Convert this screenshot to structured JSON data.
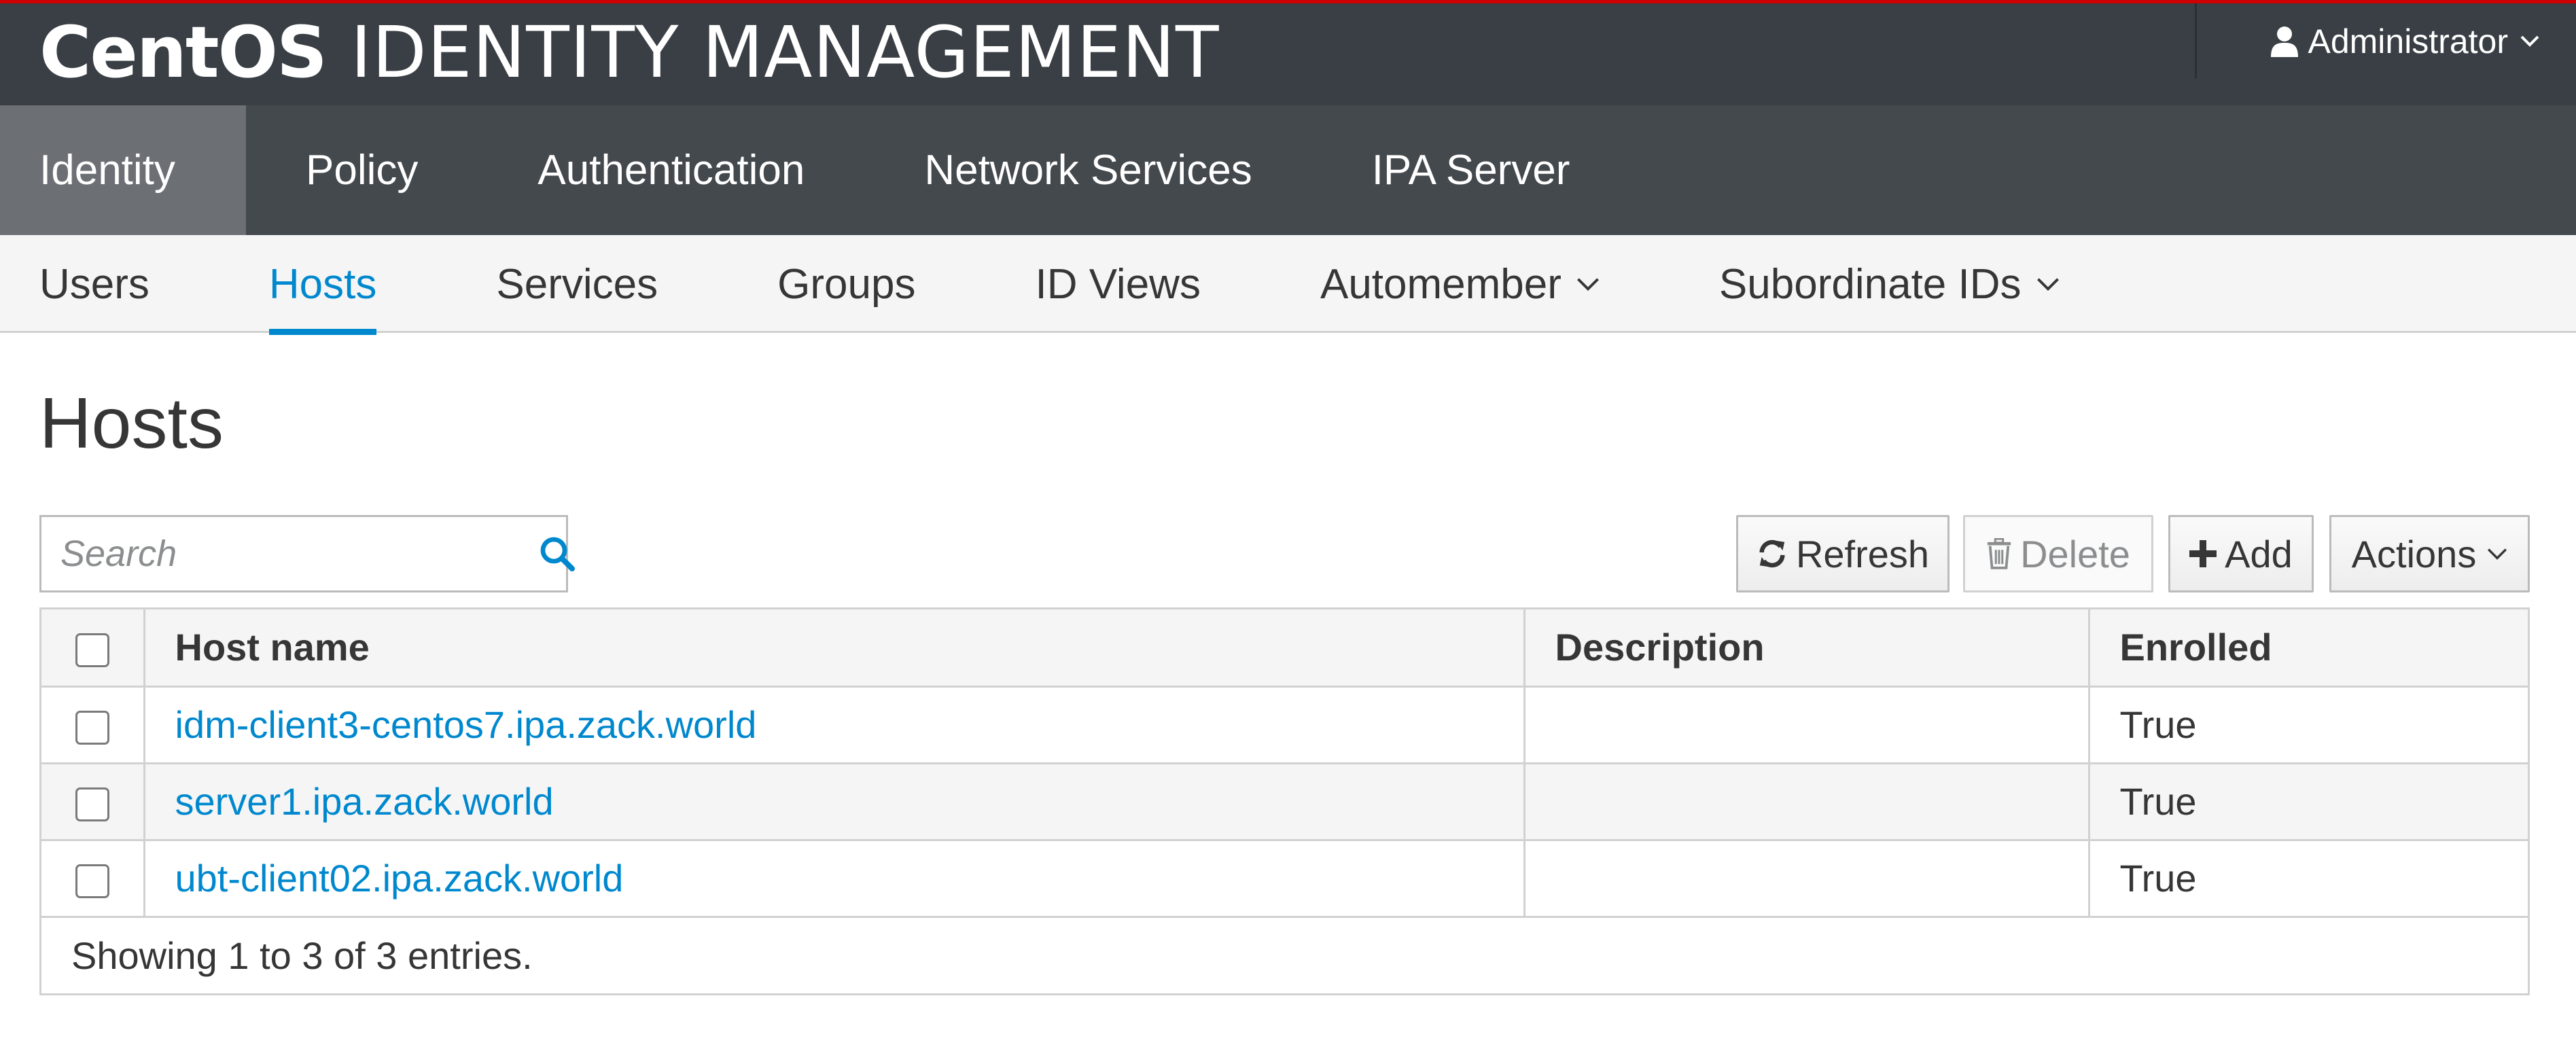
{
  "brand": {
    "bold": "CentOS",
    "light": "IDENTITY MANAGEMENT"
  },
  "user_menu": {
    "label": "Administrator",
    "icon": "user-icon"
  },
  "primary_nav": [
    {
      "label": "Identity",
      "active": true
    },
    {
      "label": "Policy",
      "active": false
    },
    {
      "label": "Authentication",
      "active": false
    },
    {
      "label": "Network Services",
      "active": false
    },
    {
      "label": "IPA Server",
      "active": false
    }
  ],
  "secondary_nav": [
    {
      "label": "Users",
      "active": false,
      "dropdown": false
    },
    {
      "label": "Hosts",
      "active": true,
      "dropdown": false
    },
    {
      "label": "Services",
      "active": false,
      "dropdown": false
    },
    {
      "label": "Groups",
      "active": false,
      "dropdown": false
    },
    {
      "label": "ID Views",
      "active": false,
      "dropdown": false
    },
    {
      "label": "Automember",
      "active": false,
      "dropdown": true
    },
    {
      "label": "Subordinate IDs",
      "active": false,
      "dropdown": true
    }
  ],
  "page": {
    "title": "Hosts"
  },
  "search": {
    "placeholder": "Search",
    "value": ""
  },
  "toolbar": {
    "refresh_label": "Refresh",
    "delete_label": "Delete",
    "add_label": "Add",
    "actions_label": "Actions"
  },
  "table": {
    "columns": [
      "Host name",
      "Description",
      "Enrolled"
    ],
    "rows": [
      {
        "host": "idm-client3-centos7.ipa.zack.world",
        "description": "",
        "enrolled": "True"
      },
      {
        "host": "server1.ipa.zack.world",
        "description": "",
        "enrolled": "True"
      },
      {
        "host": "ubt-client02.ipa.zack.world",
        "description": "",
        "enrolled": "True"
      }
    ],
    "footer": "Showing 1 to 3 of 3 entries."
  },
  "colors": {
    "brand_bar": "#393f44",
    "primary_nav": "#44494e",
    "primary_nav_active": "#6c7075",
    "accent": "#0088ce",
    "top_border": "#cc0000"
  }
}
